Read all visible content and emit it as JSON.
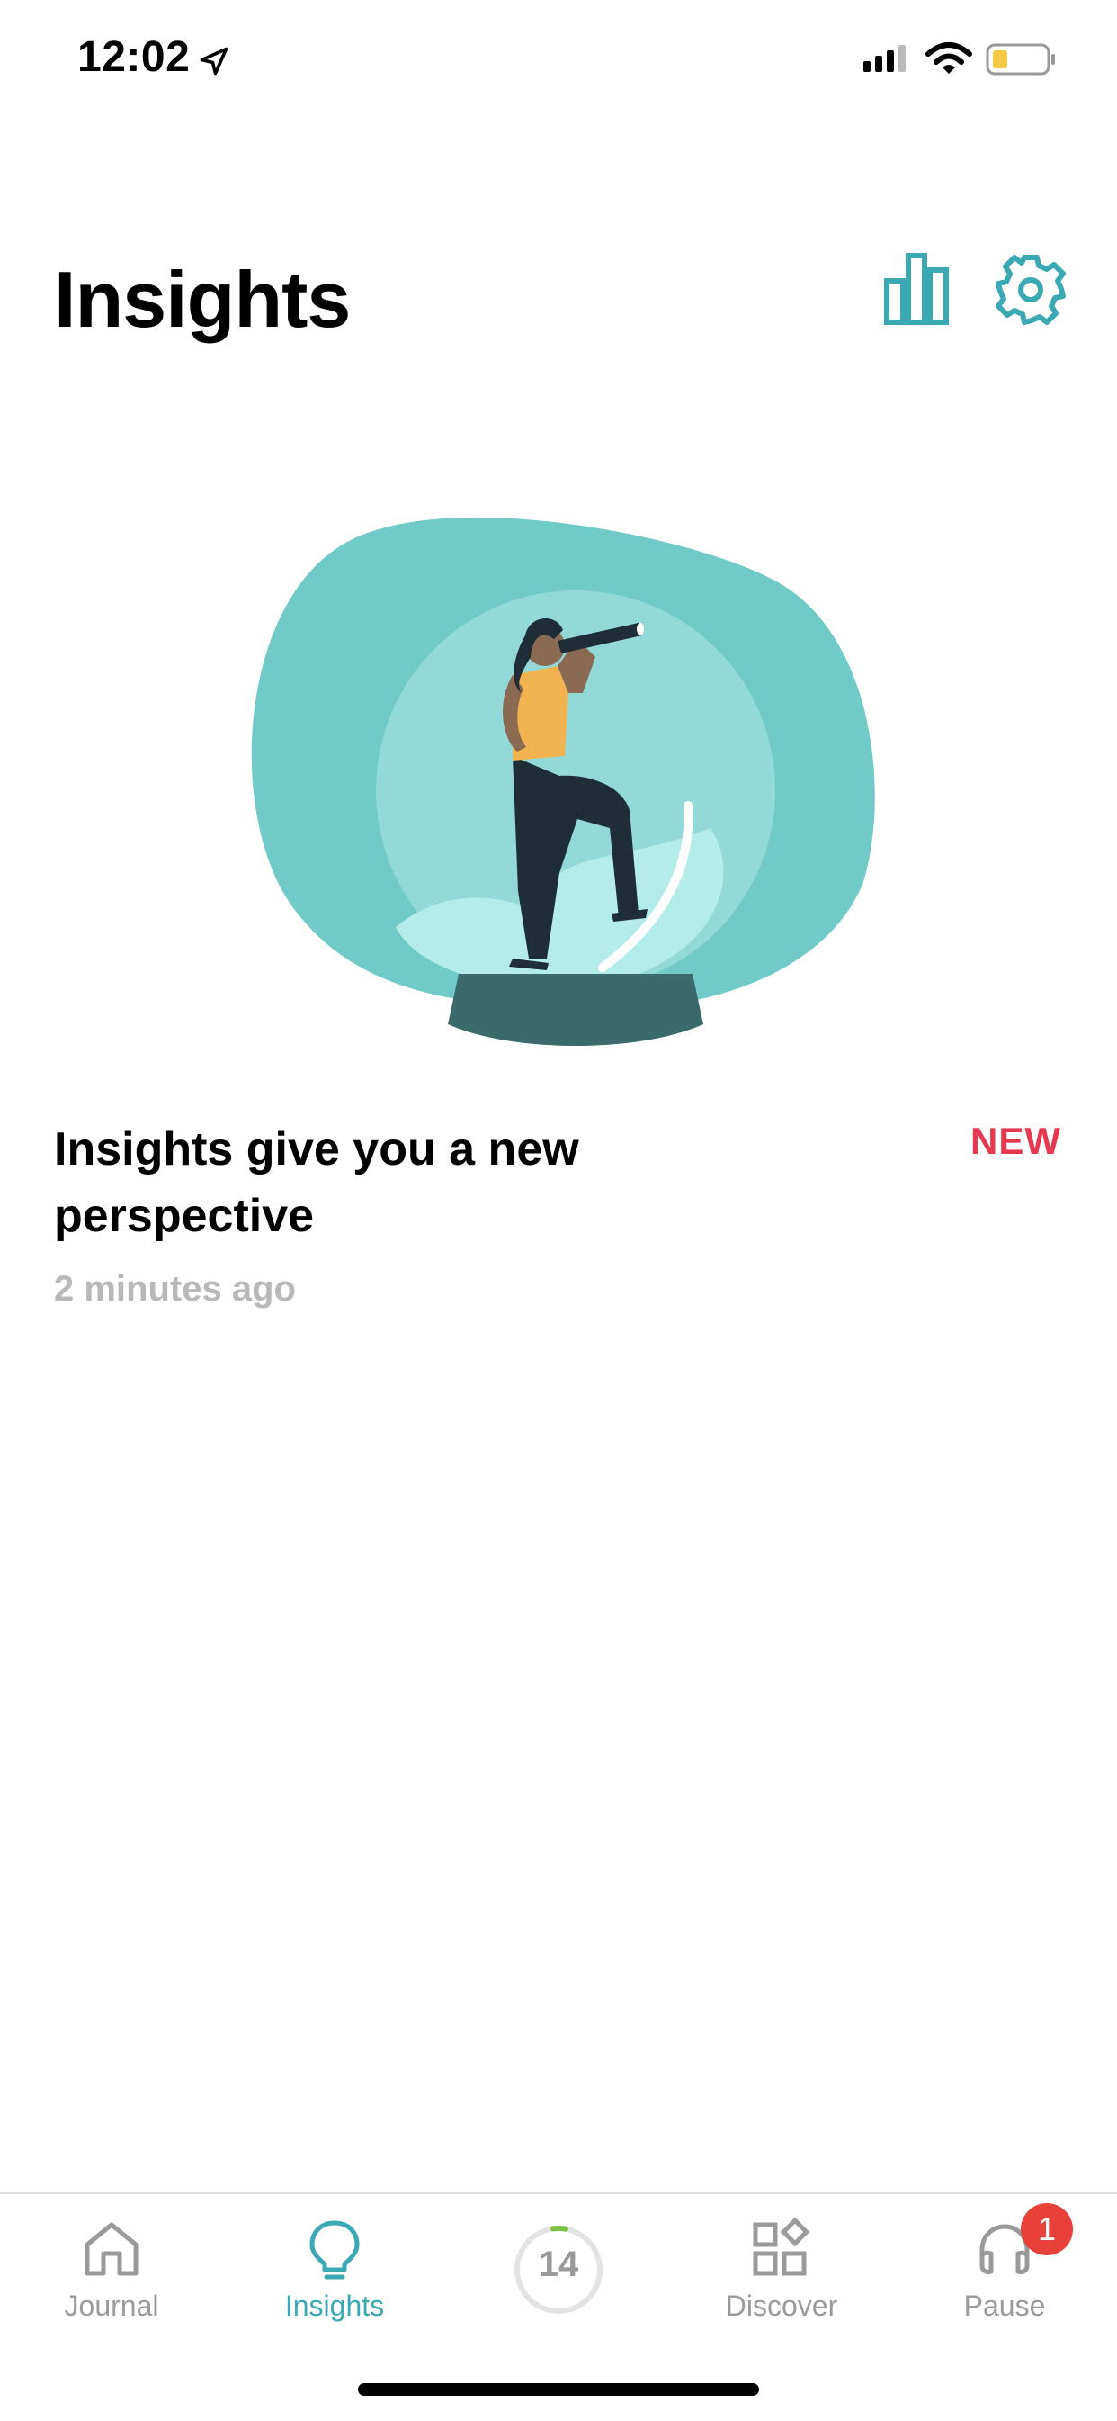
{
  "status_bar": {
    "time": "12:02"
  },
  "header": {
    "title": "Insights"
  },
  "card": {
    "title": "Insights give you a new perspective",
    "badge": "NEW",
    "time": "2 minutes ago"
  },
  "tab_bar": {
    "tabs": [
      {
        "label": "Journal"
      },
      {
        "label": "Insights"
      },
      {
        "label": ""
      },
      {
        "label": "Discover"
      },
      {
        "label": "Pause"
      }
    ],
    "progress_value": "14",
    "pause_badge": "1"
  },
  "colors": {
    "accent": "#3aa9b4",
    "new_badge": "#e63950",
    "notification_badge": "#e8413a",
    "progress_arc": "#7bc142",
    "blob": "#6fcac8"
  },
  "icons": [
    "location-arrow-icon",
    "signal-icon",
    "wifi-icon",
    "battery-icon",
    "bar-chart-icon",
    "gear-icon",
    "home-icon",
    "lightbulb-icon",
    "progress-ring-icon",
    "discover-grid-icon",
    "headphones-icon"
  ]
}
